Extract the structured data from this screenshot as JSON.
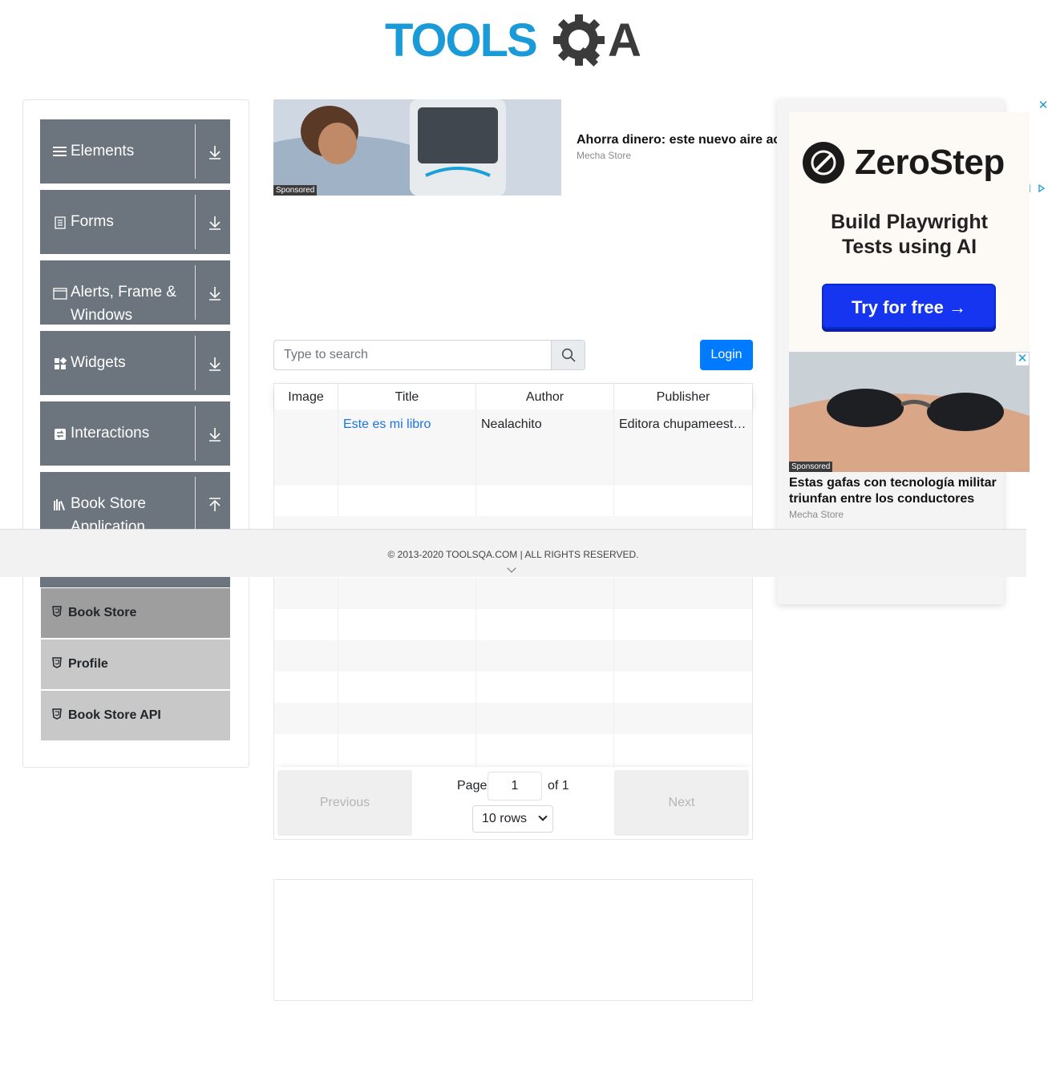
{
  "logo": {
    "text_left": "TOOLS",
    "text_right": "A",
    "alt": "ToolsQA"
  },
  "nav": {
    "groups": [
      {
        "label": "Elements",
        "icon": "hamburger-icon",
        "arrow": "download-arrow-icon"
      },
      {
        "label": "Forms",
        "icon": "document-icon",
        "arrow": "download-arrow-icon"
      },
      {
        "label": "Alerts, Frame & Windows",
        "icon": "window-icon",
        "arrow": "download-arrow-icon"
      },
      {
        "label": "Widgets",
        "icon": "widgets-grid-icon",
        "arrow": "download-arrow-icon"
      },
      {
        "label": "Interactions",
        "icon": "interactions-icon",
        "arrow": "download-arrow-icon"
      },
      {
        "label": "Book Store Application",
        "icon": "library-books-icon",
        "arrow": "upload-arrow-icon"
      }
    ],
    "subitems": [
      {
        "label": "Book Store",
        "active": true,
        "icon": "html5-shield-icon"
      },
      {
        "label": "Profile",
        "active": false,
        "icon": "html5-shield-icon"
      },
      {
        "label": "Book Store API",
        "active": false,
        "icon": "html5-shield-icon"
      }
    ]
  },
  "ads": {
    "top": {
      "title": "Ahorra dinero: este nuevo aire ac",
      "source": "Mecha Store",
      "badge": "Sponsored"
    },
    "right": {
      "brand": "ZeroStep",
      "tagline_line1": "Build Playwright",
      "tagline_line2": "Tests using AI",
      "cta": "Try for free →",
      "second_title": "Estas gafas con tecnología militar triunfan entre los conductores",
      "second_source": "Mecha Store",
      "second_badge": "Sponsored",
      "close": "✕"
    }
  },
  "search": {
    "placeholder": "Type to search",
    "icon": "search-icon"
  },
  "login": {
    "label": "Login"
  },
  "table": {
    "columns": [
      "Image",
      "Title",
      "Author",
      "Publisher"
    ],
    "rows": [
      {
        "image": "",
        "title": "Este es mi libro",
        "author": "Nealachito",
        "publisher": "Editora chupameesteh"
      }
    ]
  },
  "pagination": {
    "previous": "Previous",
    "next": "Next",
    "page_label": "Page",
    "page_value": "1",
    "of_label": "of 1",
    "rows_option": "10 rows"
  },
  "footer": {
    "text": "© 2013-2020 TOOLSQA.COM | ALL RIGHTS RESERVED."
  },
  "colors": {
    "nav_bg": "#6c757d",
    "primary": "#007bff",
    "logo_blue": "#1a9bd7",
    "logo_dark": "#3b3b3b"
  }
}
